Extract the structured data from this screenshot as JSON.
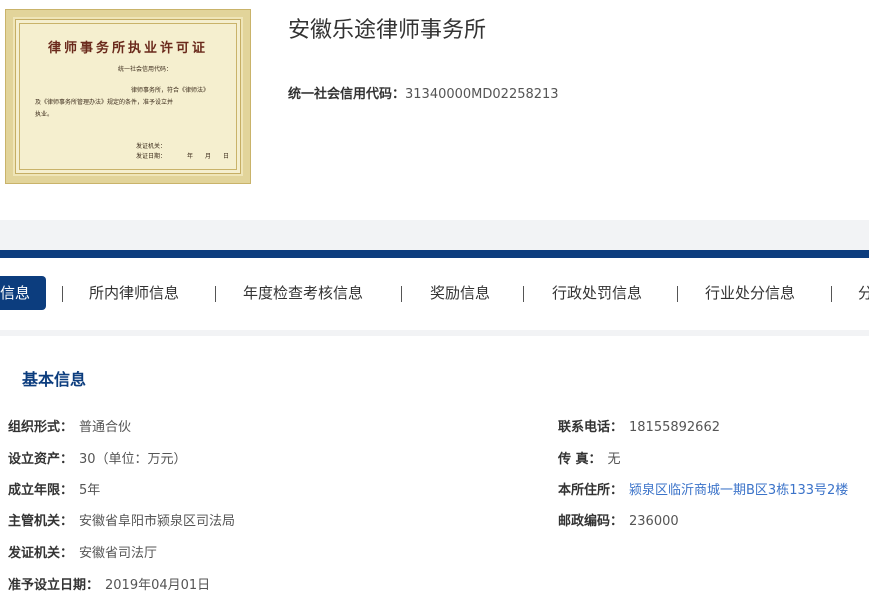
{
  "header": {
    "certificate": {
      "title": "律师事务所执业许可证",
      "line1": "统一社会信用代码：",
      "line2": "律师事务所，符合《律师法》",
      "line3": "及《律师事务所管理办法》规定的条件，准予设立并",
      "line4": "执业。",
      "line5": "发证机关：",
      "line6": "发证日期：　　　　年　　月　　日"
    },
    "firm_name": "安徽乐途律师事务所",
    "credit_label": "统一社会信用代码：",
    "credit_value": "31340000MD02258213"
  },
  "tabs": [
    {
      "label": "信息"
    },
    {
      "label": "所内律师信息"
    },
    {
      "label": "年度检查考核信息"
    },
    {
      "label": "奖励信息"
    },
    {
      "label": "行政处罚信息"
    },
    {
      "label": "行业处分信息"
    },
    {
      "label": "分"
    }
  ],
  "basic_info": {
    "title": "基本信息",
    "left": [
      {
        "label": "组织形式：",
        "value": "普通合伙"
      },
      {
        "label": "设立资产：",
        "value": "30（单位：万元）"
      },
      {
        "label": "成立年限：",
        "value": "5年"
      },
      {
        "label": "主管机关：",
        "value": "安徽省阜阳市颍泉区司法局"
      },
      {
        "label": "发证机关：",
        "value": "安徽省司法厅"
      },
      {
        "label": "准予设立日期：",
        "value": "2019年04月01日"
      }
    ],
    "right": [
      {
        "label": "联系电话：",
        "value": "18155892662"
      },
      {
        "label": "传 真：",
        "value": "无"
      },
      {
        "label": "本所住所：",
        "value": "颍泉区临沂商城一期B区3栋133号2楼"
      },
      {
        "label": "邮政编码：",
        "value": "236000"
      }
    ]
  },
  "colors": {
    "primary": "#0c3d7e",
    "link": "#3b73c9",
    "background_gap": "#f2f3f5",
    "certificate_bg": "#f5efcf"
  }
}
